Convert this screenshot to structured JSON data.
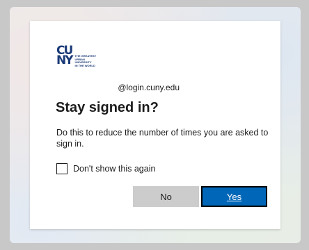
{
  "logo": {
    "letters_top": "CU",
    "letters_bottom": "NY",
    "tagline": [
      "THE GREATEST",
      "URBAN UNIVERSITY",
      "IN THE WORLD"
    ]
  },
  "account": {
    "email_visible": "@login.cuny.edu"
  },
  "dialog": {
    "title": "Stay signed in?",
    "description": "Do this to reduce the number of times you are asked to sign in.",
    "checkbox_label": "Don't show this again",
    "checkbox_checked": false
  },
  "buttons": {
    "no_label": "No",
    "yes_label": "Yes"
  },
  "colors": {
    "primary": "#0067b8",
    "secondary_button": "#cccccc",
    "logo": "#1b3a78"
  }
}
